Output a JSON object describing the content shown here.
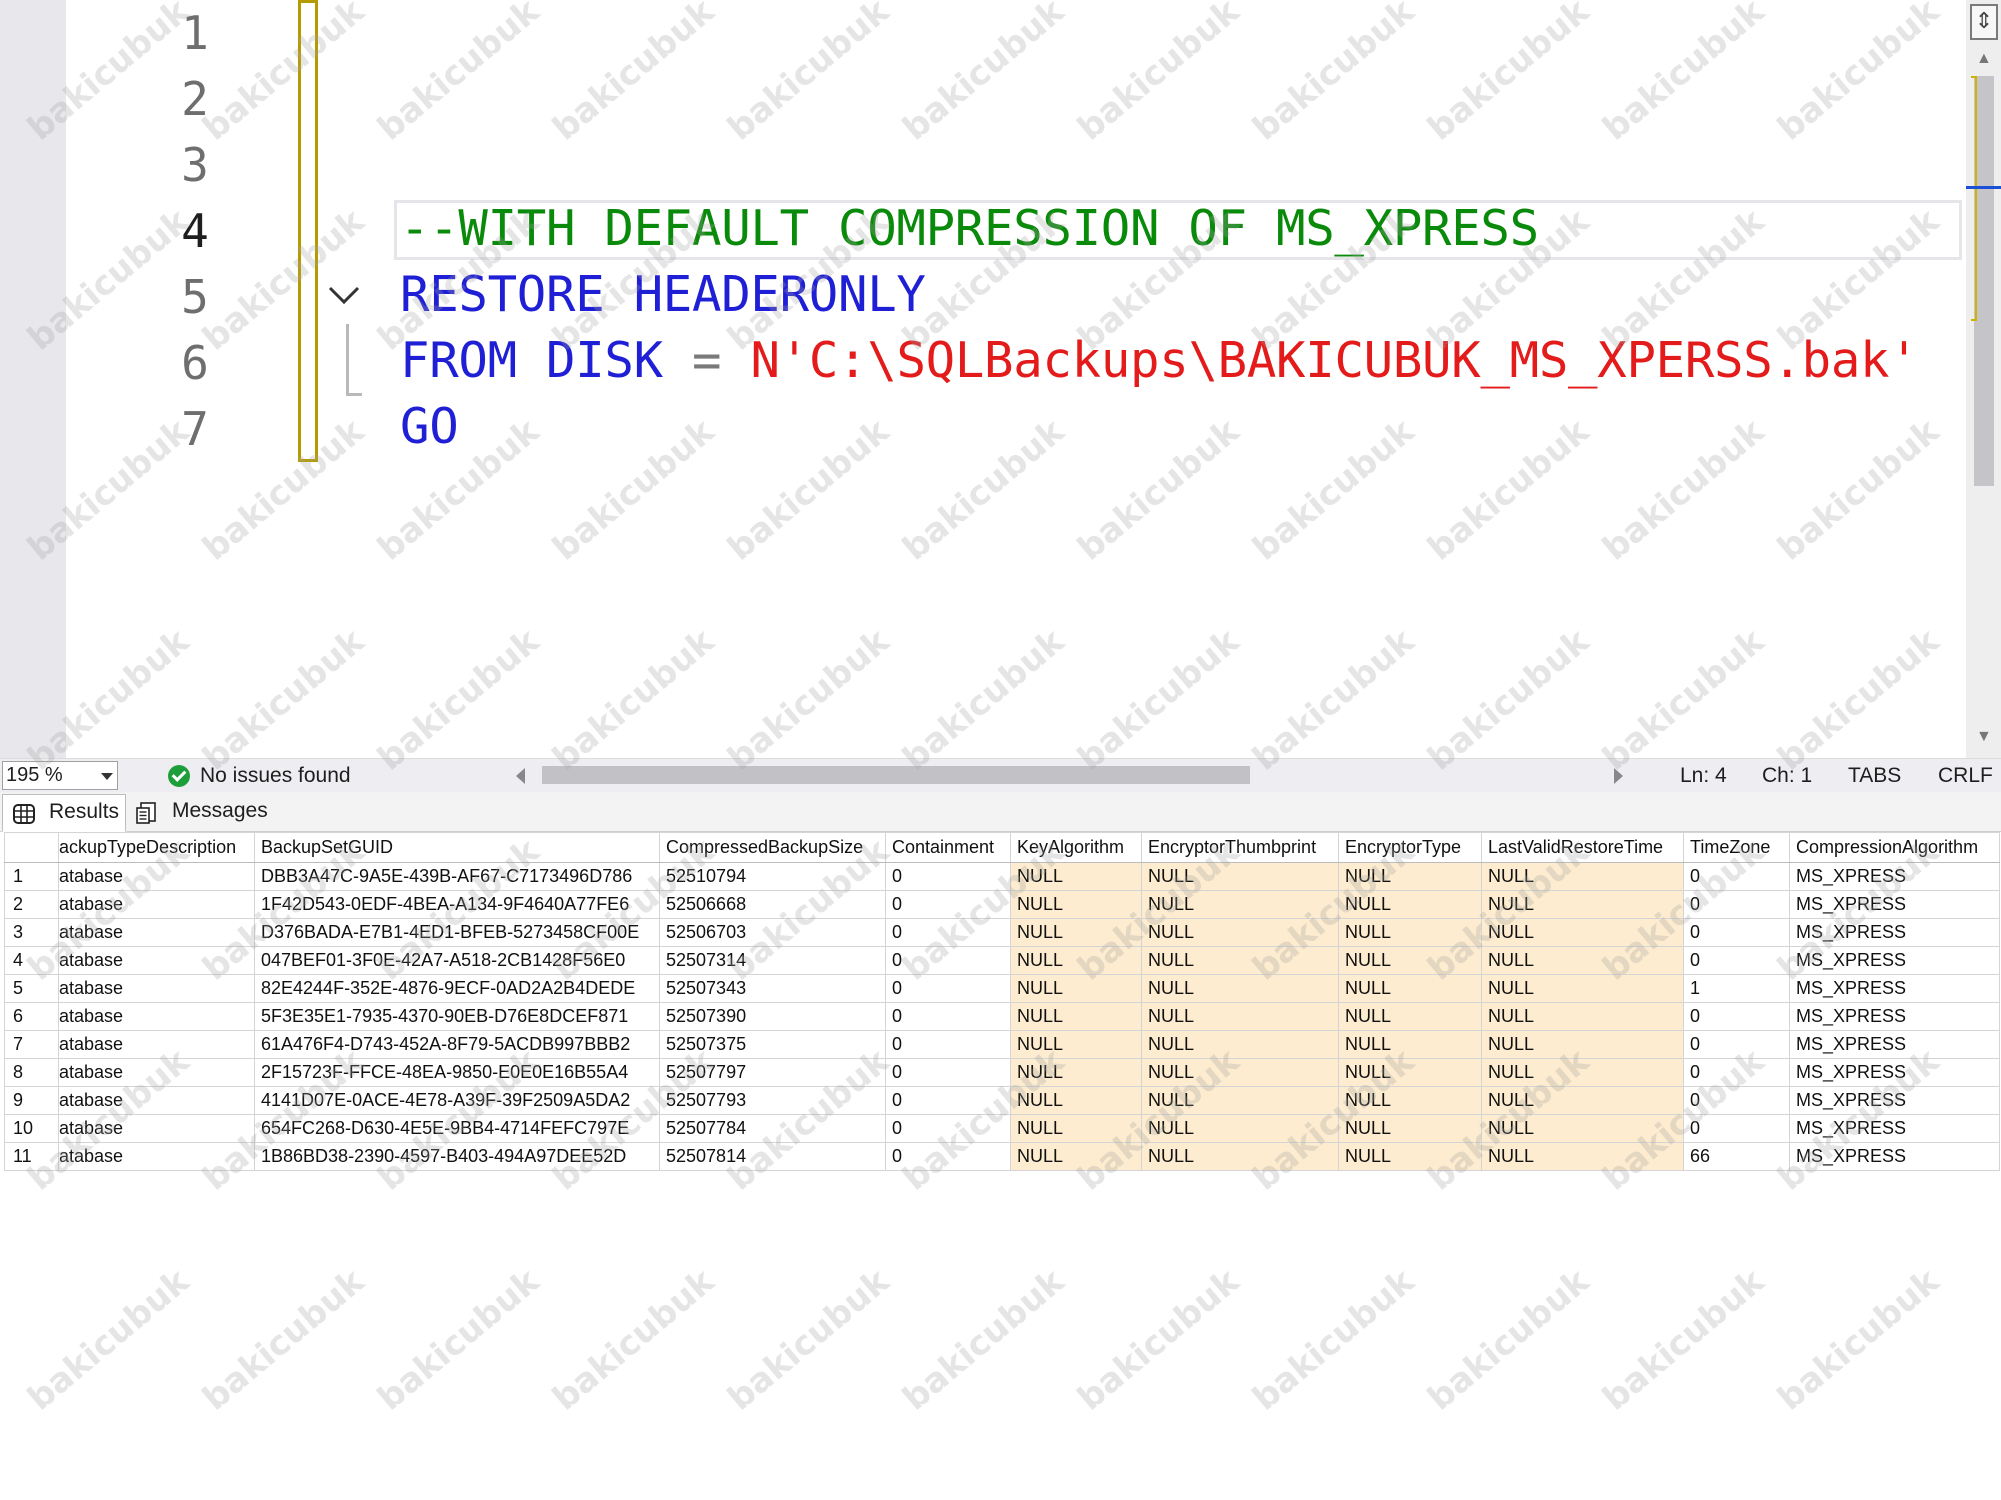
{
  "editor": {
    "line_numbers": [
      "1",
      "2",
      "3",
      "4",
      "5",
      "6",
      "7"
    ],
    "current_line": 4,
    "code": {
      "line4_comment": "--WITH DEFAULT COMPRESSION OF MS_XPRESS",
      "line5_kw1": "RESTORE",
      "line5_kw2": "HEADERONLY",
      "line6_kw1": "FROM",
      "line6_kw2": "DISK",
      "line6_op": "=",
      "line6_str": "N'C:\\SQLBackups\\BAKICUBUK_MS_XPERSS.bak'",
      "line7_kw": "GO"
    }
  },
  "statusbar": {
    "zoom": "195 %",
    "issues": "No issues found",
    "ln": "Ln: 4",
    "ch": "Ch: 1",
    "indent": "TABS",
    "line_ending": "CRLF"
  },
  "tabs": {
    "results": "Results",
    "messages": "Messages"
  },
  "grid": {
    "columns": [
      "ackupTypeDescription",
      "BackupSetGUID",
      "CompressedBackupSize",
      "Containment",
      "KeyAlgorithm",
      "EncryptorThumbprint",
      "EncryptorType",
      "LastValidRestoreTime",
      "TimeZone",
      "CompressionAlgorithm"
    ],
    "rows": [
      [
        "1",
        "atabase",
        "DBB3A47C-9A5E-439B-AF67-C7173496D786",
        "52510794",
        "0",
        "NULL",
        "NULL",
        "NULL",
        "NULL",
        "0",
        "MS_XPRESS"
      ],
      [
        "2",
        "atabase",
        "1F42D543-0EDF-4BEA-A134-9F4640A77FE6",
        "52506668",
        "0",
        "NULL",
        "NULL",
        "NULL",
        "NULL",
        "0",
        "MS_XPRESS"
      ],
      [
        "3",
        "atabase",
        "D376BADA-E7B1-4ED1-BFEB-5273458CF00E",
        "52506703",
        "0",
        "NULL",
        "NULL",
        "NULL",
        "NULL",
        "0",
        "MS_XPRESS"
      ],
      [
        "4",
        "atabase",
        "047BEF01-3F0E-42A7-A518-2CB1428F56E0",
        "52507314",
        "0",
        "NULL",
        "NULL",
        "NULL",
        "NULL",
        "0",
        "MS_XPRESS"
      ],
      [
        "5",
        "atabase",
        "82E4244F-352E-4876-9ECF-0AD2A2B4DEDE",
        "52507343",
        "0",
        "NULL",
        "NULL",
        "NULL",
        "NULL",
        "1",
        "MS_XPRESS"
      ],
      [
        "6",
        "atabase",
        "5F3E35E1-7935-4370-90EB-D76E8DCEF871",
        "52507390",
        "0",
        "NULL",
        "NULL",
        "NULL",
        "NULL",
        "0",
        "MS_XPRESS"
      ],
      [
        "7",
        "atabase",
        "61A476F4-D743-452A-8F79-5ACDB997BBB2",
        "52507375",
        "0",
        "NULL",
        "NULL",
        "NULL",
        "NULL",
        "0",
        "MS_XPRESS"
      ],
      [
        "8",
        "atabase",
        "2F15723F-FFCE-48EA-9850-E0E0E16B55A4",
        "52507797",
        "0",
        "NULL",
        "NULL",
        "NULL",
        "NULL",
        "0",
        "MS_XPRESS"
      ],
      [
        "9",
        "atabase",
        "4141D07E-0ACE-4E78-A39F-39F2509A5DA2",
        "52507793",
        "0",
        "NULL",
        "NULL",
        "NULL",
        "NULL",
        "0",
        "MS_XPRESS"
      ],
      [
        "10",
        "atabase",
        "654FC268-D630-4E5E-9BB4-4714FEFC797E",
        "52507784",
        "0",
        "NULL",
        "NULL",
        "NULL",
        "NULL",
        "0",
        "MS_XPRESS"
      ],
      [
        "11",
        "atabase",
        "1B86BD38-2390-4597-B403-494A97DEE52D",
        "52507814",
        "0",
        "NULL",
        "NULL",
        "NULL",
        "NULL",
        "66",
        "MS_XPRESS"
      ]
    ]
  },
  "watermark": "bakicubuk",
  "colors": {
    "comment": "#0a8a0a",
    "keyword": "#1f1fd6",
    "string": "#e31b1b",
    "null_cell": "#fdeccf",
    "change_bar": "#b59b00"
  }
}
